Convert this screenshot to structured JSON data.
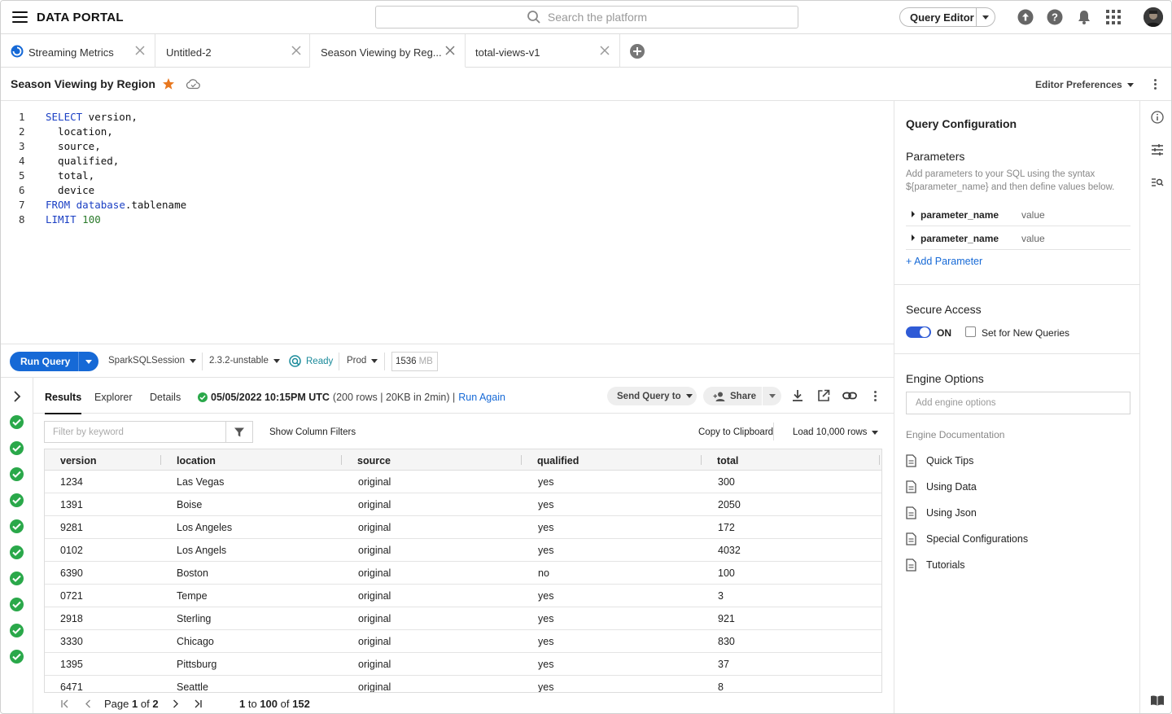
{
  "app": {
    "title": "DATA PORTAL"
  },
  "search": {
    "placeholder": "Search the platform"
  },
  "topbar": {
    "query_editor_label": "Query Editor"
  },
  "tabs": [
    {
      "label": "Streaming Metrics",
      "status_icon": "loading-spinner-icon"
    },
    {
      "label": "Untitled-2"
    },
    {
      "label": "Season Viewing by Reg..."
    },
    {
      "label": "total-views-v1"
    }
  ],
  "query": {
    "title": "Season Viewing by Region",
    "editor_prefs_label": "Editor Preferences",
    "lines": [
      {
        "n": "1",
        "segments": [
          {
            "t": "SELECT",
            "k": "kw"
          },
          {
            "t": " version,",
            "k": ""
          }
        ]
      },
      {
        "n": "2",
        "segments": [
          {
            "t": "  location,",
            "k": ""
          }
        ]
      },
      {
        "n": "3",
        "segments": [
          {
            "t": "  source,",
            "k": ""
          }
        ]
      },
      {
        "n": "4",
        "segments": [
          {
            "t": "  qualified,",
            "k": ""
          }
        ]
      },
      {
        "n": "5",
        "segments": [
          {
            "t": "  total,",
            "k": ""
          }
        ]
      },
      {
        "n": "6",
        "segments": [
          {
            "t": "  device",
            "k": ""
          }
        ]
      },
      {
        "n": "7",
        "segments": [
          {
            "t": "FROM",
            "k": "kw"
          },
          {
            "t": " ",
            "k": ""
          },
          {
            "t": "database",
            "k": "kw"
          },
          {
            "t": ".tablename",
            "k": ""
          }
        ]
      },
      {
        "n": "8",
        "segments": [
          {
            "t": "LIMIT",
            "k": "kw"
          },
          {
            "t": " ",
            "k": ""
          },
          {
            "t": "100",
            "k": "num"
          }
        ]
      }
    ]
  },
  "runbar": {
    "run_label": "Run Query",
    "session": "SparkSQLSession",
    "version": "2.3.2-unstable",
    "status": "Ready",
    "env": "Prod",
    "memory_value": "1536",
    "memory_unit": "MB"
  },
  "results": {
    "tabs": [
      "Results",
      "Explorer",
      "Details"
    ],
    "timestamp": "05/05/2022 10:15PM UTC",
    "summary": "(200 rows | 20KB in 2min) |",
    "run_again": "Run Again",
    "send_query_label": "Send Query to",
    "share_label": "Share",
    "filter_placeholder": "Filter by keyword",
    "show_column_filters": "Show Column Filters",
    "copy_clipboard": "Copy to Clipboard",
    "load_rows": "Load 10,000 rows",
    "columns": [
      "version",
      "location",
      "source",
      "qualified",
      "total"
    ],
    "rows": [
      [
        "1234",
        "Las Vegas",
        "original",
        "yes",
        "300"
      ],
      [
        "1391",
        "Boise",
        "original",
        "yes",
        "2050"
      ],
      [
        "9281",
        "Los Angeles",
        "original",
        "yes",
        "172"
      ],
      [
        "0102",
        "Los Angels",
        "original",
        "yes",
        "4032"
      ],
      [
        "6390",
        "Boston",
        "original",
        "no",
        "100"
      ],
      [
        "0721",
        "Tempe",
        "original",
        "yes",
        "3"
      ],
      [
        "2918",
        "Sterling",
        "original",
        "yes",
        "921"
      ],
      [
        "3330",
        "Chicago",
        "original",
        "yes",
        "830"
      ],
      [
        "1395",
        "Pittsburg",
        "original",
        "yes",
        "37"
      ],
      [
        "6471",
        "Seattle",
        "original",
        "yes",
        "8"
      ]
    ],
    "history_count": 11
  },
  "pager": {
    "page_prefix": "Page",
    "page": "1",
    "of": "of",
    "total_pages": "2",
    "range_start": "1",
    "to": "to",
    "range_end": "100",
    "of2": "of",
    "total_rows": "152"
  },
  "config": {
    "title": "Query Configuration",
    "params_title": "Parameters",
    "params_desc": "Add parameters to your SQL using the syntax ${parameter_name} and then define values below.",
    "params": [
      {
        "name": "parameter_name",
        "value": "value"
      },
      {
        "name": "parameter_name",
        "value": "value"
      }
    ],
    "add_param": "+ Add Parameter",
    "secure_title": "Secure Access",
    "secure_state": "ON",
    "set_new_queries": "Set for New Queries",
    "engine_title": "Engine Options",
    "engine_placeholder": "Add engine options",
    "engine_docs_title": "Engine Documentation",
    "docs": [
      "Quick Tips",
      "Using Data",
      "Using Json",
      "Special Configurations",
      "Tutorials"
    ]
  },
  "colors": {
    "primary": "#1669d6",
    "success": "#2aa84a",
    "star": "#e8771e",
    "ready": "#1a8a9a",
    "toggle": "#2f5bd6"
  }
}
